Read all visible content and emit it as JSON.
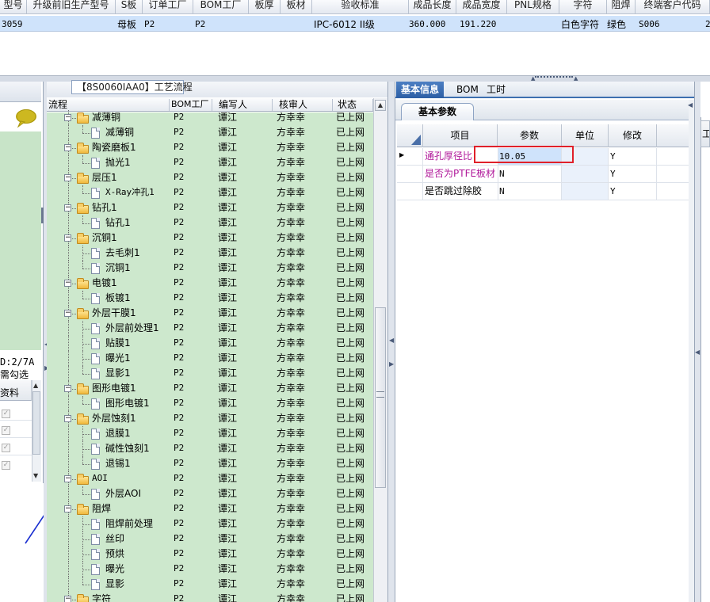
{
  "top_grid": {
    "headers": [
      "型号",
      "升级前旧生产型号",
      "S板",
      "订单工厂",
      "BOM工厂",
      "板厚",
      "板材",
      "验收标准",
      "成品长度",
      "成品宽度",
      "PNL规格",
      "字符",
      "阻焊",
      "终端客户代码"
    ],
    "row": {
      "model": "3059",
      "board_type": "母板",
      "order_factory": "P2",
      "bom_factory": "P2",
      "acceptance": "IPC-6012 II级",
      "length": "360.000",
      "width": "191.220",
      "char": "白色字符",
      "solder_mask": "绿色",
      "customer_code": "S006",
      "extra": "2"
    }
  },
  "left_panel": {
    "status_line1": "D:2/7A",
    "status_line2": "需勾选",
    "col_header": "资料",
    "checked_mark": "✓"
  },
  "middle_panel": {
    "title": "【8S0060IAA0】工艺流程",
    "headers": [
      "流程",
      "BOM工厂",
      "编写人",
      "核审人",
      "状态"
    ],
    "rows": [
      {
        "name": "减薄铜",
        "level": 0,
        "bom": "P2",
        "writer": "谭江",
        "reviewer": "方幸幸",
        "status": "已上网"
      },
      {
        "name": "减薄铜",
        "level": 1,
        "bom": "P2",
        "writer": "谭江",
        "reviewer": "方幸幸",
        "status": "已上网"
      },
      {
        "name": "陶瓷磨板1",
        "level": 0,
        "bom": "P2",
        "writer": "谭江",
        "reviewer": "方幸幸",
        "status": "已上网"
      },
      {
        "name": "抛光1",
        "level": 1,
        "bom": "P2",
        "writer": "谭江",
        "reviewer": "方幸幸",
        "status": "已上网"
      },
      {
        "name": "层压1",
        "level": 0,
        "bom": "P2",
        "writer": "谭江",
        "reviewer": "方幸幸",
        "status": "已上网"
      },
      {
        "name": "X-Ray冲孔1",
        "level": 1,
        "bom": "P2",
        "writer": "谭江",
        "reviewer": "方幸幸",
        "status": "已上网"
      },
      {
        "name": "钻孔1",
        "level": 0,
        "bom": "P2",
        "writer": "谭江",
        "reviewer": "方幸幸",
        "status": "已上网"
      },
      {
        "name": "钻孔1",
        "level": 1,
        "bom": "P2",
        "writer": "谭江",
        "reviewer": "方幸幸",
        "status": "已上网"
      },
      {
        "name": "沉铜1",
        "level": 0,
        "bom": "P2",
        "writer": "谭江",
        "reviewer": "方幸幸",
        "status": "已上网"
      },
      {
        "name": "去毛刺1",
        "level": 1,
        "bom": "P2",
        "writer": "谭江",
        "reviewer": "方幸幸",
        "status": "已上网"
      },
      {
        "name": "沉铜1",
        "level": 1,
        "bom": "P2",
        "writer": "谭江",
        "reviewer": "方幸幸",
        "status": "已上网"
      },
      {
        "name": "电镀1",
        "level": 0,
        "bom": "P2",
        "writer": "谭江",
        "reviewer": "方幸幸",
        "status": "已上网"
      },
      {
        "name": "板镀1",
        "level": 1,
        "bom": "P2",
        "writer": "谭江",
        "reviewer": "方幸幸",
        "status": "已上网"
      },
      {
        "name": "外层干膜1",
        "level": 0,
        "bom": "P2",
        "writer": "谭江",
        "reviewer": "方幸幸",
        "status": "已上网"
      },
      {
        "name": "外层前处理1",
        "level": 1,
        "bom": "P2",
        "writer": "谭江",
        "reviewer": "方幸幸",
        "status": "已上网"
      },
      {
        "name": "贴膜1",
        "level": 1,
        "bom": "P2",
        "writer": "谭江",
        "reviewer": "方幸幸",
        "status": "已上网"
      },
      {
        "name": "曝光1",
        "level": 1,
        "bom": "P2",
        "writer": "谭江",
        "reviewer": "方幸幸",
        "status": "已上网"
      },
      {
        "name": "显影1",
        "level": 1,
        "bom": "P2",
        "writer": "谭江",
        "reviewer": "方幸幸",
        "status": "已上网"
      },
      {
        "name": "图形电镀1",
        "level": 0,
        "bom": "P2",
        "writer": "谭江",
        "reviewer": "方幸幸",
        "status": "已上网"
      },
      {
        "name": "图形电镀1",
        "level": 1,
        "bom": "P2",
        "writer": "谭江",
        "reviewer": "方幸幸",
        "status": "已上网"
      },
      {
        "name": "外层蚀刻1",
        "level": 0,
        "bom": "P2",
        "writer": "谭江",
        "reviewer": "方幸幸",
        "status": "已上网"
      },
      {
        "name": "退膜1",
        "level": 1,
        "bom": "P2",
        "writer": "谭江",
        "reviewer": "方幸幸",
        "status": "已上网"
      },
      {
        "name": "碱性蚀刻1",
        "level": 1,
        "bom": "P2",
        "writer": "谭江",
        "reviewer": "方幸幸",
        "status": "已上网"
      },
      {
        "name": "退锡1",
        "level": 1,
        "bom": "P2",
        "writer": "谭江",
        "reviewer": "方幸幸",
        "status": "已上网"
      },
      {
        "name": "AOI",
        "level": 0,
        "bom": "P2",
        "writer": "谭江",
        "reviewer": "方幸幸",
        "status": "已上网"
      },
      {
        "name": "外层AOI",
        "level": 1,
        "bom": "P2",
        "writer": "谭江",
        "reviewer": "方幸幸",
        "status": "已上网"
      },
      {
        "name": "阻焊",
        "level": 0,
        "bom": "P2",
        "writer": "谭江",
        "reviewer": "方幸幸",
        "status": "已上网"
      },
      {
        "name": "阻焊前处理",
        "level": 1,
        "bom": "P2",
        "writer": "谭江",
        "reviewer": "方幸幸",
        "status": "已上网"
      },
      {
        "name": "丝印",
        "level": 1,
        "bom": "P2",
        "writer": "谭江",
        "reviewer": "方幸幸",
        "status": "已上网"
      },
      {
        "name": "预烘",
        "level": 1,
        "bom": "P2",
        "writer": "谭江",
        "reviewer": "方幸幸",
        "status": "已上网"
      },
      {
        "name": "曝光",
        "level": 1,
        "bom": "P2",
        "writer": "谭江",
        "reviewer": "方幸幸",
        "status": "已上网"
      },
      {
        "name": "显影",
        "level": 1,
        "bom": "P2",
        "writer": "谭江",
        "reviewer": "方幸幸",
        "status": "已上网"
      },
      {
        "name": "字符",
        "level": 0,
        "bom": "P2",
        "writer": "谭江",
        "reviewer": "方幸幸",
        "status": "已上网"
      }
    ]
  },
  "right_panel": {
    "tabs": [
      "基本信息",
      "BOM",
      "工时"
    ],
    "subtab": "基本参数",
    "headers": [
      "项目",
      "参数",
      "单位",
      "修改"
    ],
    "rows": [
      {
        "item": "通孔厚径比",
        "param": "10.05",
        "unit": "",
        "modify": "Y"
      },
      {
        "item": "是否为PTFE板材",
        "param": "N",
        "unit": "",
        "modify": "Y"
      },
      {
        "item": "是否跳过除胶",
        "param": "N",
        "unit": "",
        "modify": "Y"
      }
    ],
    "edge_label": "工"
  },
  "colors": {
    "tree_bg": "#cde8cd",
    "selected_row": "#cfe3fb",
    "active_tab": "#2d5fa5",
    "highlight_box": "#e0202a",
    "magenta_text": "#b0189a",
    "arrow": "#1a2fd0"
  }
}
